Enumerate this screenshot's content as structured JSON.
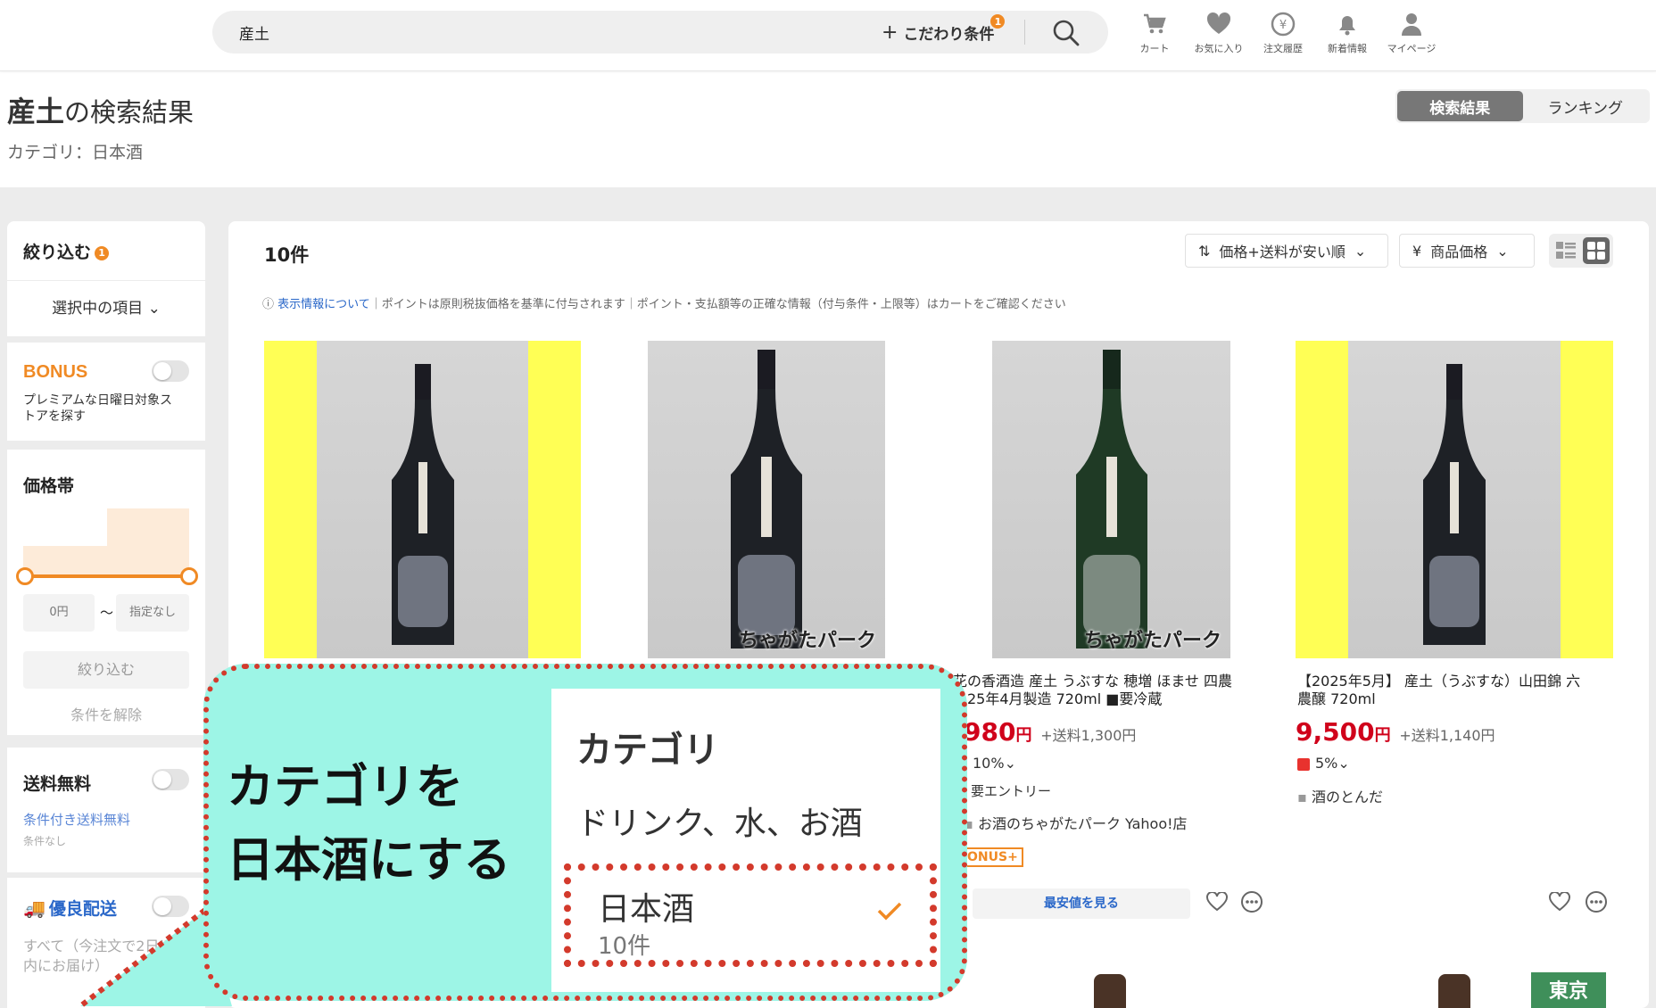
{
  "header": {
    "search_value": "産土",
    "kodawari_label": "こだわり条件",
    "kodawari_badge": "1",
    "nav": [
      {
        "label": "カート",
        "icon": "cart-icon"
      },
      {
        "label": "お気に入り",
        "icon": "heart-icon"
      },
      {
        "label": "注文履歴",
        "icon": "order-history-icon"
      },
      {
        "label": "新着情報",
        "icon": "bell-icon"
      },
      {
        "label": "マイページ",
        "icon": "user-icon"
      }
    ]
  },
  "page": {
    "keyword": "産土",
    "title_suffix": "の検索結果",
    "category_line": "カテゴリ：日本酒",
    "tabs": [
      "検索結果",
      "ランキング"
    ]
  },
  "sidebar": {
    "filter_title": "絞り込む",
    "filter_badge": "1",
    "selected_items": "選択中の項目",
    "bonus_logo": "BONUS",
    "bonus_desc": "プレミアムな日曜日対象ストアを探す",
    "price_title": "価格帯",
    "price_min": "0円",
    "price_sep": "〜",
    "price_max": "指定なし",
    "apply_button": "絞り込む",
    "clear_button": "条件を解除",
    "free_shipping": "送料無料",
    "conditional_free": "条件付き送料無料",
    "conditional_note": "条件なし",
    "yuryo": "優良配送",
    "yuryo_desc": "すべて（今注文で2日以内にお届け）"
  },
  "results": {
    "count": "10件",
    "sort": "価格+送料が安い順",
    "price_type": "商品価格",
    "notice_link": "表示情報について",
    "notice_text": "｜ポイントは原則税抜価格を基準に付与されます｜ポイント・支払額等の正確な情報（付与条件・上限等）はカートをご確認ください",
    "watermark": "ちゃがたパーク",
    "products": [
      {
        "title_l1": "花の香酒造 産土 うぶすな 穂増 ほませ 四農",
        "title_l2": "25年4月製造 720ml ■要冷蔵",
        "price": "980",
        "yen": "円",
        "shipping": "+送料1,300円",
        "points": "10%",
        "entry": "要エントリー",
        "store": "お酒のちゃがたパーク Yahoo!店",
        "bonus": "ONUS+",
        "cheapest": "最安値を見る"
      },
      {
        "title_l1": "【2025年5月】 産土（うぶすな）山田錦 六",
        "title_l2": "農醸 720ml",
        "price": "9,500",
        "yen": "円",
        "shipping": "+送料1,140円",
        "points": "5%",
        "store": "酒のとんだ"
      }
    ],
    "tokyo_badge": "東京"
  },
  "callout": {
    "line1": "カテゴリを",
    "line2": "日本酒にする",
    "panel_title": "カテゴリ",
    "parent_category": "ドリンク、水、お酒",
    "selected_category": "日本酒",
    "selected_count": "10件"
  },
  "colors": {
    "accent": "#f08a24",
    "price_red": "#d0021b",
    "callout_bg": "#9df5e6",
    "callout_border": "#d33a2c"
  }
}
